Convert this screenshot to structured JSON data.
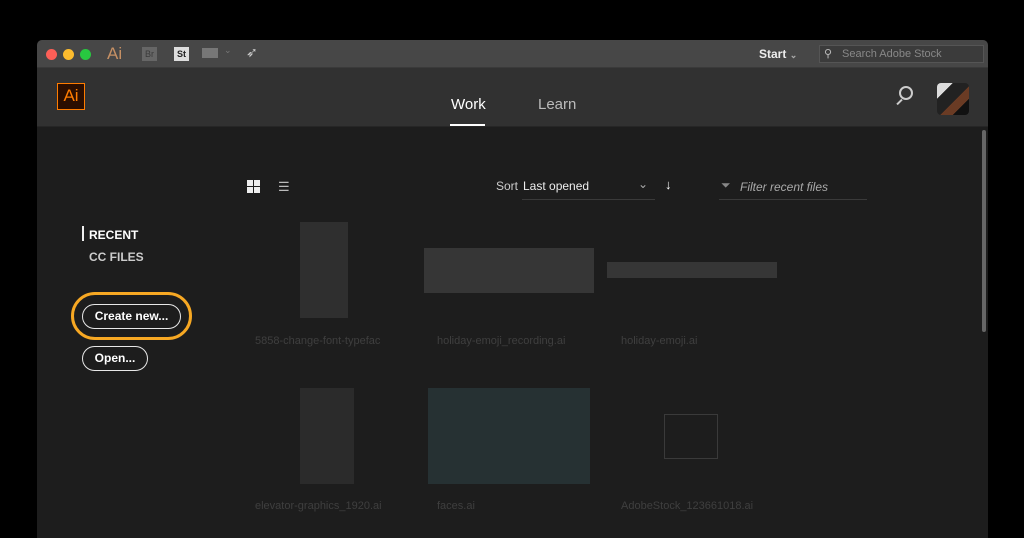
{
  "titlebar": {
    "app_icon": "Ai",
    "bridge": "Br",
    "stock": "St",
    "workspace": "Start",
    "search_placeholder": "Search Adobe Stock"
  },
  "header": {
    "logo": "Ai",
    "tabs": [
      {
        "label": "Work",
        "active": true
      },
      {
        "label": "Learn",
        "active": false
      }
    ]
  },
  "sidebar": {
    "items": [
      {
        "label": "RECENT",
        "active": true
      },
      {
        "label": "CC FILES",
        "active": false
      }
    ],
    "create_new": "Create new...",
    "open": "Open..."
  },
  "toolbar": {
    "sort_label": "Sort",
    "sort_value": "Last opened",
    "filter_placeholder": "Filter recent files"
  },
  "files": [
    {
      "name": "5858-change-font-typefac"
    },
    {
      "name": "holiday-emoji_recording.ai"
    },
    {
      "name": "holiday-emoji.ai"
    },
    {
      "name": "elevator-graphics_1920.ai"
    },
    {
      "name": "faces.ai"
    },
    {
      "name": "AdobeStock_123661018.ai"
    }
  ],
  "colors": {
    "accent": "#f7a823",
    "ai_orange": "#ff7c00",
    "ai_bg": "#2b0e00"
  }
}
